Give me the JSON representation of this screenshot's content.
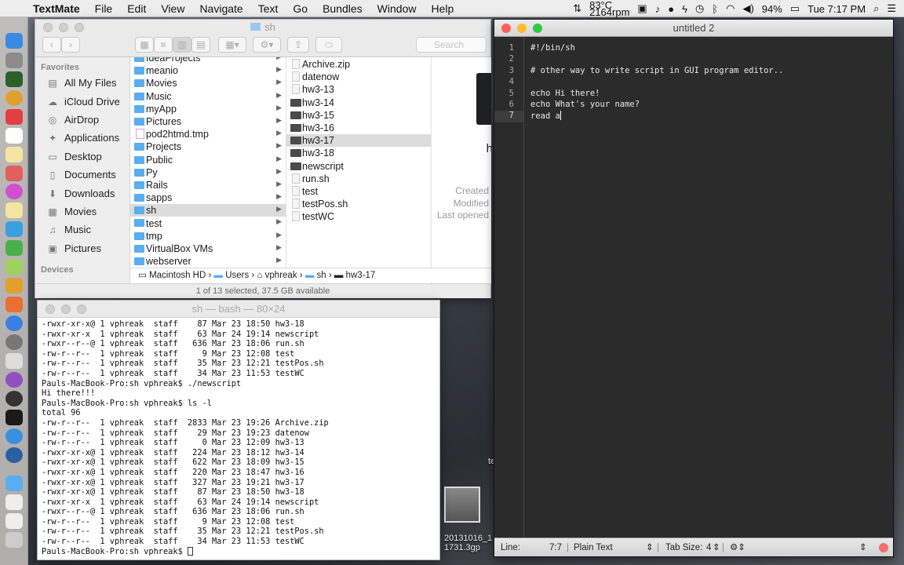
{
  "menubar": {
    "app": "TextMate",
    "items": [
      "File",
      "Edit",
      "View",
      "Navigate",
      "Text",
      "Go",
      "Bundles",
      "Window",
      "Help"
    ],
    "temp": "83°C",
    "rpm": "2164rpm",
    "battery": "94%",
    "clock": "Tue 7:17 PM"
  },
  "finder": {
    "title": "sh",
    "search_placeholder": "Search",
    "favorites_header": "Favorites",
    "devices_header": "Devices",
    "sidebar": [
      {
        "label": "All My Files",
        "icon": "all-files-icon",
        "glyph": "▤"
      },
      {
        "label": "iCloud Drive",
        "icon": "cloud-icon",
        "glyph": "☁"
      },
      {
        "label": "AirDrop",
        "icon": "airdrop-icon",
        "glyph": "◎"
      },
      {
        "label": "Applications",
        "icon": "applications-icon",
        "glyph": "✦"
      },
      {
        "label": "Desktop",
        "icon": "desktop-icon",
        "glyph": "▭"
      },
      {
        "label": "Documents",
        "icon": "documents-icon",
        "glyph": "▯"
      },
      {
        "label": "Downloads",
        "icon": "downloads-icon",
        "glyph": "⬇"
      },
      {
        "label": "Movies",
        "icon": "movies-icon",
        "glyph": "▦"
      },
      {
        "label": "Music",
        "icon": "music-icon",
        "glyph": "♫"
      },
      {
        "label": "Pictures",
        "icon": "pictures-icon",
        "glyph": "▣"
      }
    ],
    "col1": [
      {
        "label": "IdeaProjects",
        "k": "folder"
      },
      {
        "label": "meanio",
        "k": "folder"
      },
      {
        "label": "Movies",
        "k": "folder"
      },
      {
        "label": "Music",
        "k": "folder"
      },
      {
        "label": "myApp",
        "k": "folder"
      },
      {
        "label": "Pictures",
        "k": "folder"
      },
      {
        "label": "pod2htmd.tmp",
        "k": "pod"
      },
      {
        "label": "Projects",
        "k": "folder"
      },
      {
        "label": "Public",
        "k": "folder"
      },
      {
        "label": "Py",
        "k": "folder"
      },
      {
        "label": "Rails",
        "k": "folder"
      },
      {
        "label": "sapps",
        "k": "folder"
      },
      {
        "label": "sh",
        "k": "folder",
        "sel": true
      },
      {
        "label": "test",
        "k": "folder"
      },
      {
        "label": "tmp",
        "k": "folder"
      },
      {
        "label": "VirtualBox VMs",
        "k": "folder"
      },
      {
        "label": "webserver",
        "k": "folder"
      }
    ],
    "col2": [
      {
        "label": "Archive.zip",
        "k": "doc"
      },
      {
        "label": "datenow",
        "k": "doc"
      },
      {
        "label": "hw3-13",
        "k": "doc"
      },
      {
        "label": "hw3-14",
        "k": "exec"
      },
      {
        "label": "hw3-15",
        "k": "exec"
      },
      {
        "label": "hw3-16",
        "k": "exec"
      },
      {
        "label": "hw3-17",
        "k": "exec",
        "sel": true
      },
      {
        "label": "hw3-18",
        "k": "exec"
      },
      {
        "label": "newscript",
        "k": "exec"
      },
      {
        "label": "run.sh",
        "k": "doc"
      },
      {
        "label": "test",
        "k": "doc"
      },
      {
        "label": "testPos.sh",
        "k": "doc"
      },
      {
        "label": "testWC",
        "k": "doc"
      }
    ],
    "preview": {
      "name": "h",
      "created": "Created",
      "modified": "Modified",
      "last_opened": "Last opened"
    },
    "path": [
      "Macintosh HD",
      "Users",
      "vphreak",
      "sh",
      "hw3-17"
    ],
    "status": "1 of 13 selected, 37.5 GB available"
  },
  "terminal": {
    "title": "sh — bash — 80×24",
    "lines": [
      "-rwxr-xr-x@ 1 vphreak  staff    87 Mar 23 18:50 hw3-18",
      "-rwxr-xr-x  1 vphreak  staff    63 Mar 24 19:14 newscript",
      "-rwxr--r--@ 1 vphreak  staff   636 Mar 23 18:06 run.sh",
      "-rw-r--r--  1 vphreak  staff     9 Mar 23 12:08 test",
      "-rw-r--r--  1 vphreak  staff    35 Mar 23 12:21 testPos.sh",
      "-rw-r--r--  1 vphreak  staff    34 Mar 23 11:53 testWC",
      "Pauls-MacBook-Pro:sh vphreak$ ./newscript",
      "Hi there!!!",
      "Pauls-MacBook-Pro:sh vphreak$ ls -l",
      "total 96",
      "-rw-r--r--  1 vphreak  staff  2833 Mar 23 19:26 Archive.zip",
      "-rw-r--r--  1 vphreak  staff    29 Mar 23 19:23 datenow",
      "-rw-r--r--  1 vphreak  staff     0 Mar 23 12:09 hw3-13",
      "-rwxr-xr-x@ 1 vphreak  staff   224 Mar 23 18:12 hw3-14",
      "-rwxr-xr-x@ 1 vphreak  staff   622 Mar 23 18:09 hw3-15",
      "-rwxr-xr-x@ 1 vphreak  staff   220 Mar 23 18:47 hw3-16",
      "-rwxr-xr-x@ 1 vphreak  staff   327 Mar 23 19:21 hw3-17",
      "-rwxr-xr-x@ 1 vphreak  staff    87 Mar 23 18:50 hw3-18",
      "-rwxr-xr-x  1 vphreak  staff    63 Mar 24 19:14 newscript",
      "-rwxr--r--@ 1 vphreak  staff   636 Mar 23 18:06 run.sh",
      "-rw-r--r--  1 vphreak  staff     9 Mar 23 12:08 test",
      "-rw-r--r--  1 vphreak  staff    35 Mar 23 12:21 testPos.sh",
      "-rw-r--r--  1 vphreak  staff    34 Mar 23 11:53 testWC"
    ],
    "prompt": "Pauls-MacBook-Pro:sh vphreak$ "
  },
  "textmate": {
    "title": "untitled 2",
    "lines": [
      "#!/bin/sh",
      "",
      "# other way to write script in GUI program editor..",
      "",
      "echo Hi there!",
      "echo What's your name?",
      "read a"
    ],
    "current_line": 7,
    "status": {
      "line_label": "Line:",
      "position": "7:7",
      "grammar": "Plain Text",
      "tab_label": "Tab Size:",
      "tab_size": "4"
    }
  },
  "desktop": {
    "file1": "20131016_1",
    "file2": "1731.3gp",
    "partial": "te"
  }
}
